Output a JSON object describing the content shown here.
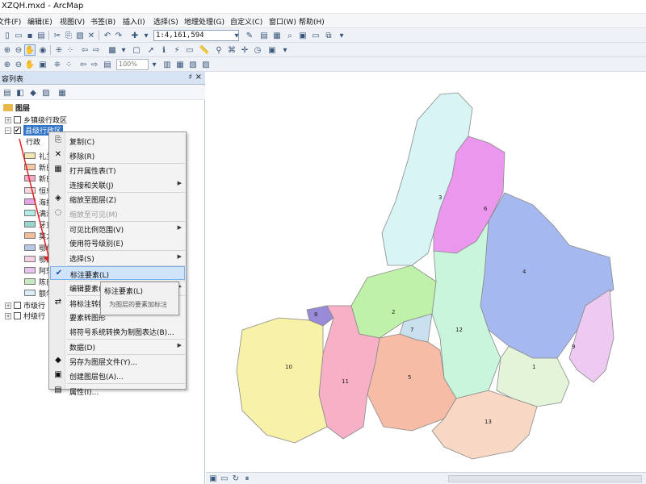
{
  "window": {
    "title": "XZQH.mxd - ArcMap"
  },
  "menu": {
    "items": [
      "文件(F)",
      "编辑(E)",
      "视图(V)",
      "书签(B)",
      "插入(I)",
      "选择(S)",
      "地理处理(G)",
      "自定义(C)",
      "窗口(W)",
      "帮助(H)"
    ]
  },
  "toolbar": {
    "scale_value": "1:4,161,594",
    "zoom_value": "100%"
  },
  "toc": {
    "title": "容列表",
    "pin": "♯",
    "close": "×",
    "root_label": "图层",
    "layers": [
      {
        "label": "乡镇级行政区",
        "checked": false
      },
      {
        "label": "县级行政区",
        "checked": true
      },
      {
        "label": "市级行",
        "checked": false
      },
      {
        "label": "村级行",
        "checked": false
      }
    ],
    "field_label": "行政",
    "legend": [
      {
        "label": "礼兰",
        "color": "#f3e6b4"
      },
      {
        "label": "新巴",
        "color": "#f6c8a8"
      },
      {
        "label": "新巴",
        "color": "#f5a8c8"
      },
      {
        "label": "恒乐",
        "color": "#f7d6dc"
      },
      {
        "label": "海拉",
        "color": "#e5a4e3"
      },
      {
        "label": "满洲",
        "color": "#b2ece7"
      },
      {
        "label": "牙克",
        "color": "#9ad6d0"
      },
      {
        "label": "莫力",
        "color": "#f4bd9a"
      },
      {
        "label": "鄂伦",
        "color": "#b8c9e8"
      },
      {
        "label": "鄂温",
        "color": "#f5d0e6"
      },
      {
        "label": "阿荣",
        "color": "#e7c4f0"
      },
      {
        "label": "陈巴",
        "color": "#c6e9bf"
      },
      {
        "label": "额尔",
        "color": "#d9ecf5"
      }
    ]
  },
  "context_menu": {
    "items": [
      {
        "label": "复制(C)",
        "icon": "copy-icon",
        "glyph": "⎘",
        "submenu": false,
        "disabled": false,
        "highlight": false
      },
      {
        "label": "移除(R)",
        "icon": "remove-icon",
        "glyph": "✕",
        "submenu": false,
        "disabled": false,
        "highlight": false
      },
      {
        "label": "打开属性表(T)",
        "icon": "table-icon",
        "glyph": "▦",
        "submenu": false,
        "disabled": false,
        "highlight": false
      },
      {
        "label": "连接和关联(J)",
        "icon": "",
        "glyph": "",
        "submenu": true,
        "disabled": false,
        "highlight": false
      },
      {
        "label": "缩放至图层(Z)",
        "icon": "zoom-layer-icon",
        "glyph": "◈",
        "submenu": false,
        "disabled": false,
        "highlight": false
      },
      {
        "label": "缩放至可见(M)",
        "icon": "zoom-visible-icon",
        "glyph": "◌",
        "submenu": false,
        "disabled": true,
        "highlight": false
      },
      {
        "label": "可见比例范围(V)",
        "icon": "",
        "glyph": "",
        "submenu": true,
        "disabled": false,
        "highlight": false
      },
      {
        "label": "使用符号级别(E)",
        "icon": "",
        "glyph": "",
        "submenu": false,
        "disabled": false,
        "highlight": false
      },
      {
        "label": "选择(S)",
        "icon": "",
        "glyph": "",
        "submenu": true,
        "disabled": false,
        "highlight": false
      },
      {
        "label": "标注要素(L)",
        "icon": "check-icon",
        "glyph": "✔",
        "submenu": false,
        "disabled": false,
        "highlight": true
      },
      {
        "label": "编辑要素(E)",
        "icon": "",
        "glyph": "",
        "submenu": true,
        "disabled": false,
        "highlight": false
      },
      {
        "label": "将标注转换",
        "icon": "convert-labels-icon",
        "glyph": "⇄",
        "submenu": false,
        "disabled": false,
        "highlight": false
      },
      {
        "label": "要素转图形",
        "icon": "",
        "glyph": "",
        "submenu": false,
        "disabled": false,
        "highlight": false
      },
      {
        "label": "将符号系统转换为制图表达(B)...",
        "icon": "",
        "glyph": "",
        "submenu": false,
        "disabled": false,
        "highlight": false
      },
      {
        "label": "数据(D)",
        "icon": "",
        "glyph": "",
        "submenu": true,
        "disabled": false,
        "highlight": false
      },
      {
        "label": "另存为图层文件(Y)...",
        "icon": "save-layer-icon",
        "glyph": "◆",
        "submenu": false,
        "disabled": false,
        "highlight": false
      },
      {
        "label": "创建图层包(A)...",
        "icon": "layer-package-icon",
        "glyph": "▣",
        "submenu": false,
        "disabled": false,
        "highlight": false
      },
      {
        "label": "属性(I)...",
        "icon": "properties-icon",
        "glyph": "▤",
        "submenu": false,
        "disabled": false,
        "highlight": false
      }
    ]
  },
  "tooltip": {
    "title": "标注要素(L)",
    "description": "为图层的要素加标注"
  },
  "map": {
    "regions": [
      {
        "id": "1",
        "color": "#e3f4d9"
      },
      {
        "id": "2",
        "color": "#bff1a9"
      },
      {
        "id": "3",
        "color": "#d8f4f4"
      },
      {
        "id": "4",
        "color": "#a6b8f0"
      },
      {
        "id": "5",
        "color": "#f6bca5"
      },
      {
        "id": "6",
        "color": "#ec97ee"
      },
      {
        "id": "7",
        "color": "#c9e0ef"
      },
      {
        "id": "8",
        "color": "#9a8bd8"
      },
      {
        "id": "9",
        "color": "#eecaf2"
      },
      {
        "id": "10",
        "color": "#f8f1a8"
      },
      {
        "id": "11",
        "color": "#f7b0c6"
      },
      {
        "id": "12",
        "color": "#c9f5dc"
      },
      {
        "id": "13",
        "color": "#f8d8c4"
      }
    ]
  }
}
